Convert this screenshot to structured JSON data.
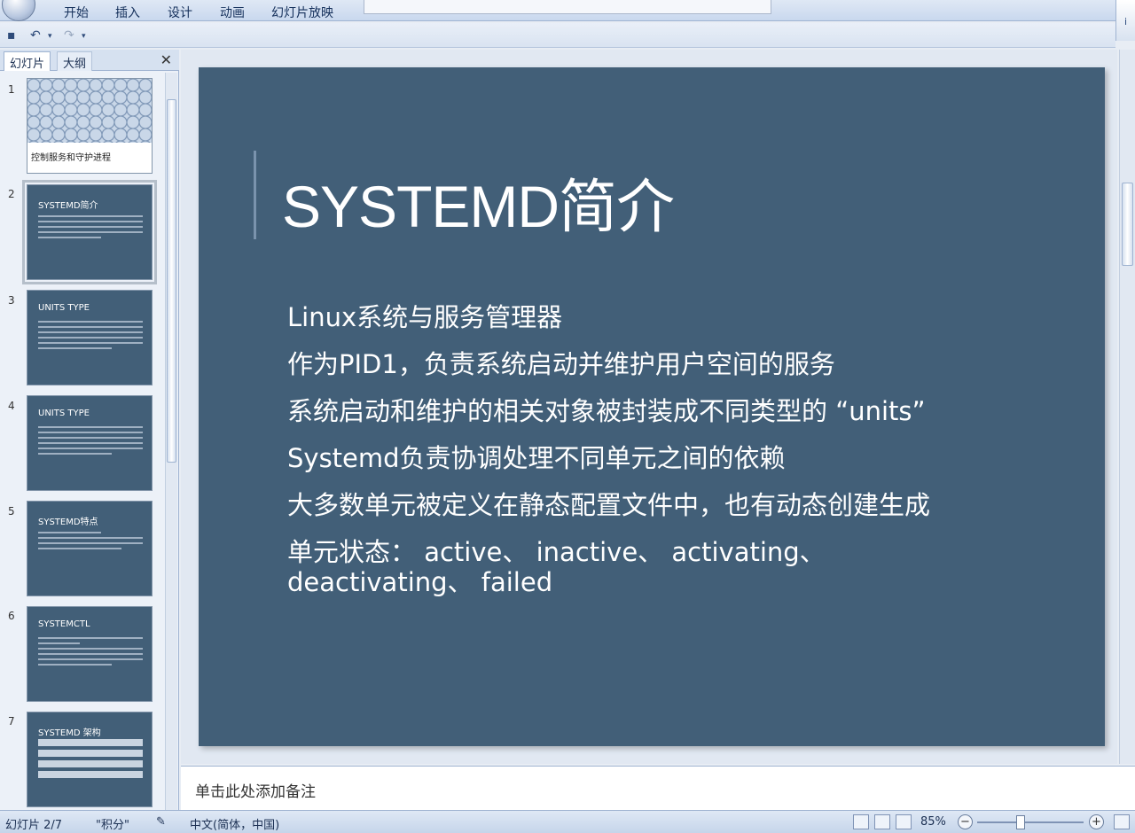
{
  "ribbon": {
    "tabs": [
      "开始",
      "插入",
      "设计",
      "动画",
      "幻灯片放映"
    ]
  },
  "left_pane": {
    "tab_slides": "幻灯片",
    "tab_outline": "大纲",
    "close": "✕",
    "thumbnails": [
      {
        "num": "1",
        "title": "控制服务和守护进程"
      },
      {
        "num": "2",
        "title": "SYSTEMD简介"
      },
      {
        "num": "3",
        "title": "UNITS TYPE"
      },
      {
        "num": "4",
        "title": "UNITS TYPE"
      },
      {
        "num": "5",
        "title": "SYSTEMD特点"
      },
      {
        "num": "6",
        "title": "SYSTEMCTL"
      },
      {
        "num": "7",
        "title": "SYSTEMD 架构"
      }
    ]
  },
  "slide": {
    "title": "SYSTEMD简介",
    "bullets": [
      "Linux系统与服务管理器",
      "作为PID1，负责系统启动并维护用户空间的服务",
      "系统启动和维护的相关对象被封装成不同类型的 “units”",
      "Systemd负责协调处理不同单元之间的依赖",
      "大多数单元被定义在静态配置文件中，也有动态创建生成",
      "单元状态： active、 inactive、 activating、 deactivating、 failed"
    ]
  },
  "notes": {
    "placeholder": "单击此处添加备注"
  },
  "status": {
    "slide_info": "幻灯片 2/7",
    "theme": "\"积分\"",
    "language": "中文(简体，中国)",
    "zoom": "85%"
  },
  "colors": {
    "slide_bg": "#425f78",
    "ribbon_bg": "#dfe8f5"
  }
}
